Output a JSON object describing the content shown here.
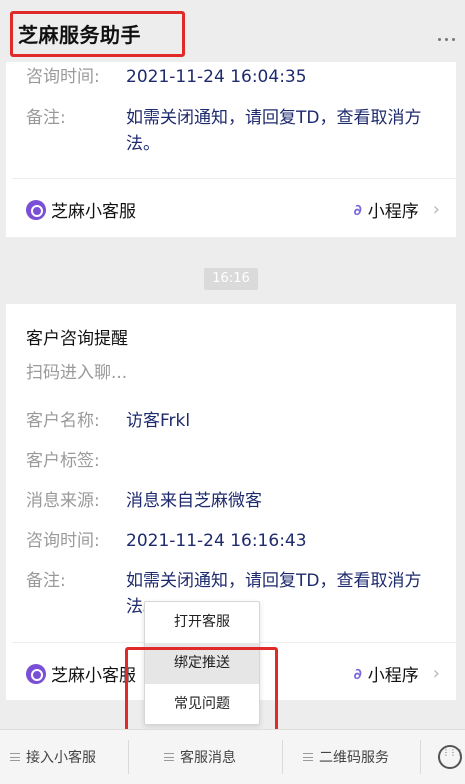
{
  "window": {
    "title": "芝麻服务助手"
  },
  "card1": {
    "rows": [
      {
        "key": "咨询时间:",
        "value": "2021-11-24 16:04:35"
      },
      {
        "key": "备注:",
        "value": "如需关闭通知，请回复TD，查看取消方法。"
      }
    ],
    "footer": {
      "brand": "芝麻小客服",
      "mini_program": "小程序"
    }
  },
  "timestamp": "16:16",
  "card2": {
    "title": "客户咨询提醒",
    "subtitle": "扫码进入聊...",
    "rows": [
      {
        "key": "客户名称:",
        "value": "访客Frkl"
      },
      {
        "key": "客户标签:",
        "value": ""
      },
      {
        "key": "消息来源:",
        "value": "消息来自芝麻微客"
      },
      {
        "key": "咨询时间:",
        "value": "2021-11-24 16:16:43"
      },
      {
        "key": "备注:",
        "value": "如需关闭通知，请回复TD，查看取消方法。"
      }
    ],
    "footer": {
      "brand": "芝麻小客服",
      "mini_program": "小程序"
    }
  },
  "popup_menu": {
    "items": [
      "打开客服",
      "绑定推送",
      "常见问题"
    ],
    "active_index": 1
  },
  "bottom_menu": {
    "tabs": [
      "接入小客服",
      "客服消息",
      "二维码服务"
    ]
  },
  "colors": {
    "highlight_box": "#e02a2a",
    "value_text": "#1e2a6e",
    "brand_icon": "#7a4fd6"
  }
}
